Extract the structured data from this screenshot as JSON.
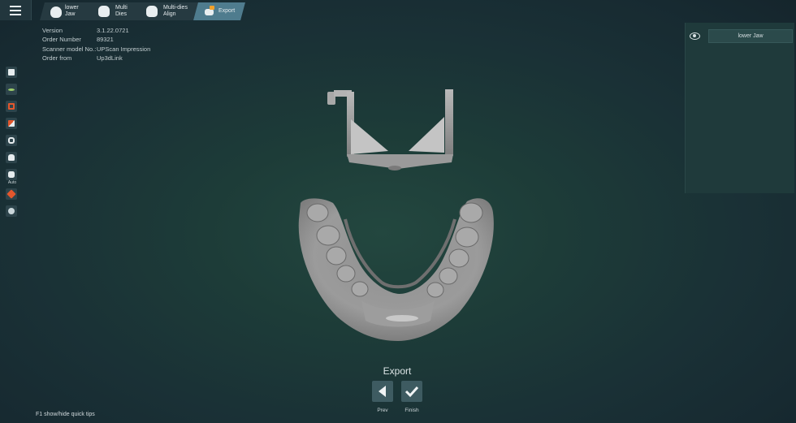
{
  "toolbar": {
    "menu_icon": "hamburger-icon",
    "steps": [
      {
        "line1": "lower",
        "line2": "Jaw",
        "icon": "jaw-icon"
      },
      {
        "line1": "Multi",
        "line2": "Dies",
        "icon": "die-icon"
      },
      {
        "line1": "Multi-dies",
        "line2": "Align",
        "icon": "die-align-icon"
      },
      {
        "line1": "Export",
        "line2": "",
        "icon": "export-icon",
        "active": true
      }
    ]
  },
  "info": {
    "version_label": "Version",
    "version_value": "3.1.22.0721",
    "order_label": "Order Number",
    "order_value": "89321",
    "scanner_label": "Scanner model No.:",
    "scanner_value": "UPScan Impression",
    "from_label": "Order from",
    "from_value": "Up3dLink"
  },
  "tools": {
    "auto_label": "Auto"
  },
  "panel": {
    "layer_name": "lower Jaw"
  },
  "footer": {
    "title": "Export",
    "prev_label": "Prev",
    "finish_label": "Finish",
    "tips": "F1 show/hide quick tips"
  },
  "colors": {
    "accent_active": "#4f7c8e",
    "background": "#1d3c38",
    "tool_orange": "#e3572d"
  }
}
